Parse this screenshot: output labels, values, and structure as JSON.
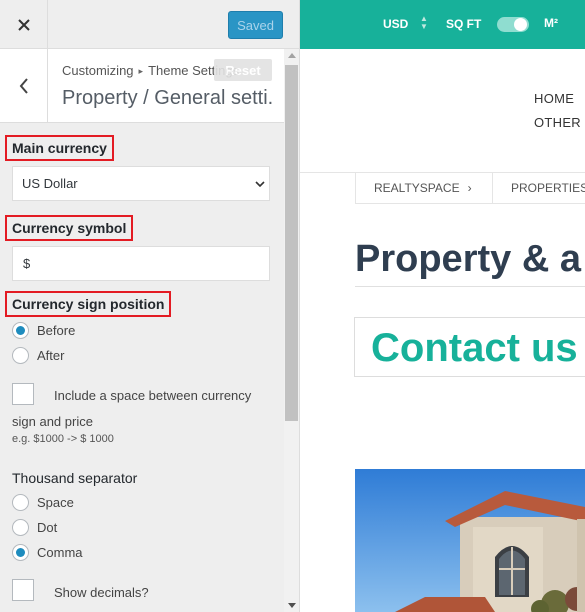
{
  "customizer": {
    "saved_label": "Saved",
    "breadcrumb": {
      "root": "Customizing",
      "parent": "Theme Settings"
    },
    "reset_label": "Reset",
    "section_title": "Property / General setti..."
  },
  "controls": {
    "main_currency": {
      "label": "Main currency",
      "selected": "US Dollar"
    },
    "currency_symbol": {
      "label": "Currency symbol",
      "value": "$"
    },
    "currency_sign_position": {
      "label": "Currency sign position",
      "options": [
        {
          "label": "Before",
          "checked": true
        },
        {
          "label": "After",
          "checked": false
        }
      ]
    },
    "space_option": {
      "label_line1": "Include a space between currency",
      "label_line2": "sign and price",
      "description": "e.g. $1000 -> $ 1000",
      "checked": false
    },
    "thousand_separator": {
      "label": "Thousand separator",
      "options": [
        {
          "label": "Space",
          "checked": false
        },
        {
          "label": "Dot",
          "checked": false
        },
        {
          "label": "Comma",
          "checked": true
        }
      ]
    },
    "show_decimals": {
      "label": "Show decimals?",
      "checked": false
    }
  },
  "preview": {
    "topbar": {
      "currency": "USD",
      "unit_left": "SQ FT",
      "unit_right": "M²",
      "toggle_on": true
    },
    "nav": [
      "HOME",
      "OTHER"
    ],
    "breadcrumb": [
      "REALTYSPACE",
      "PROPERTIES"
    ],
    "heading": "Property & a",
    "contact_title": "Contact us"
  },
  "colors": {
    "accent_teal": "#17b19a",
    "button_blue": "#2a95c5",
    "highlight_red": "#e31b23",
    "heading_dark": "#2f3e50"
  }
}
